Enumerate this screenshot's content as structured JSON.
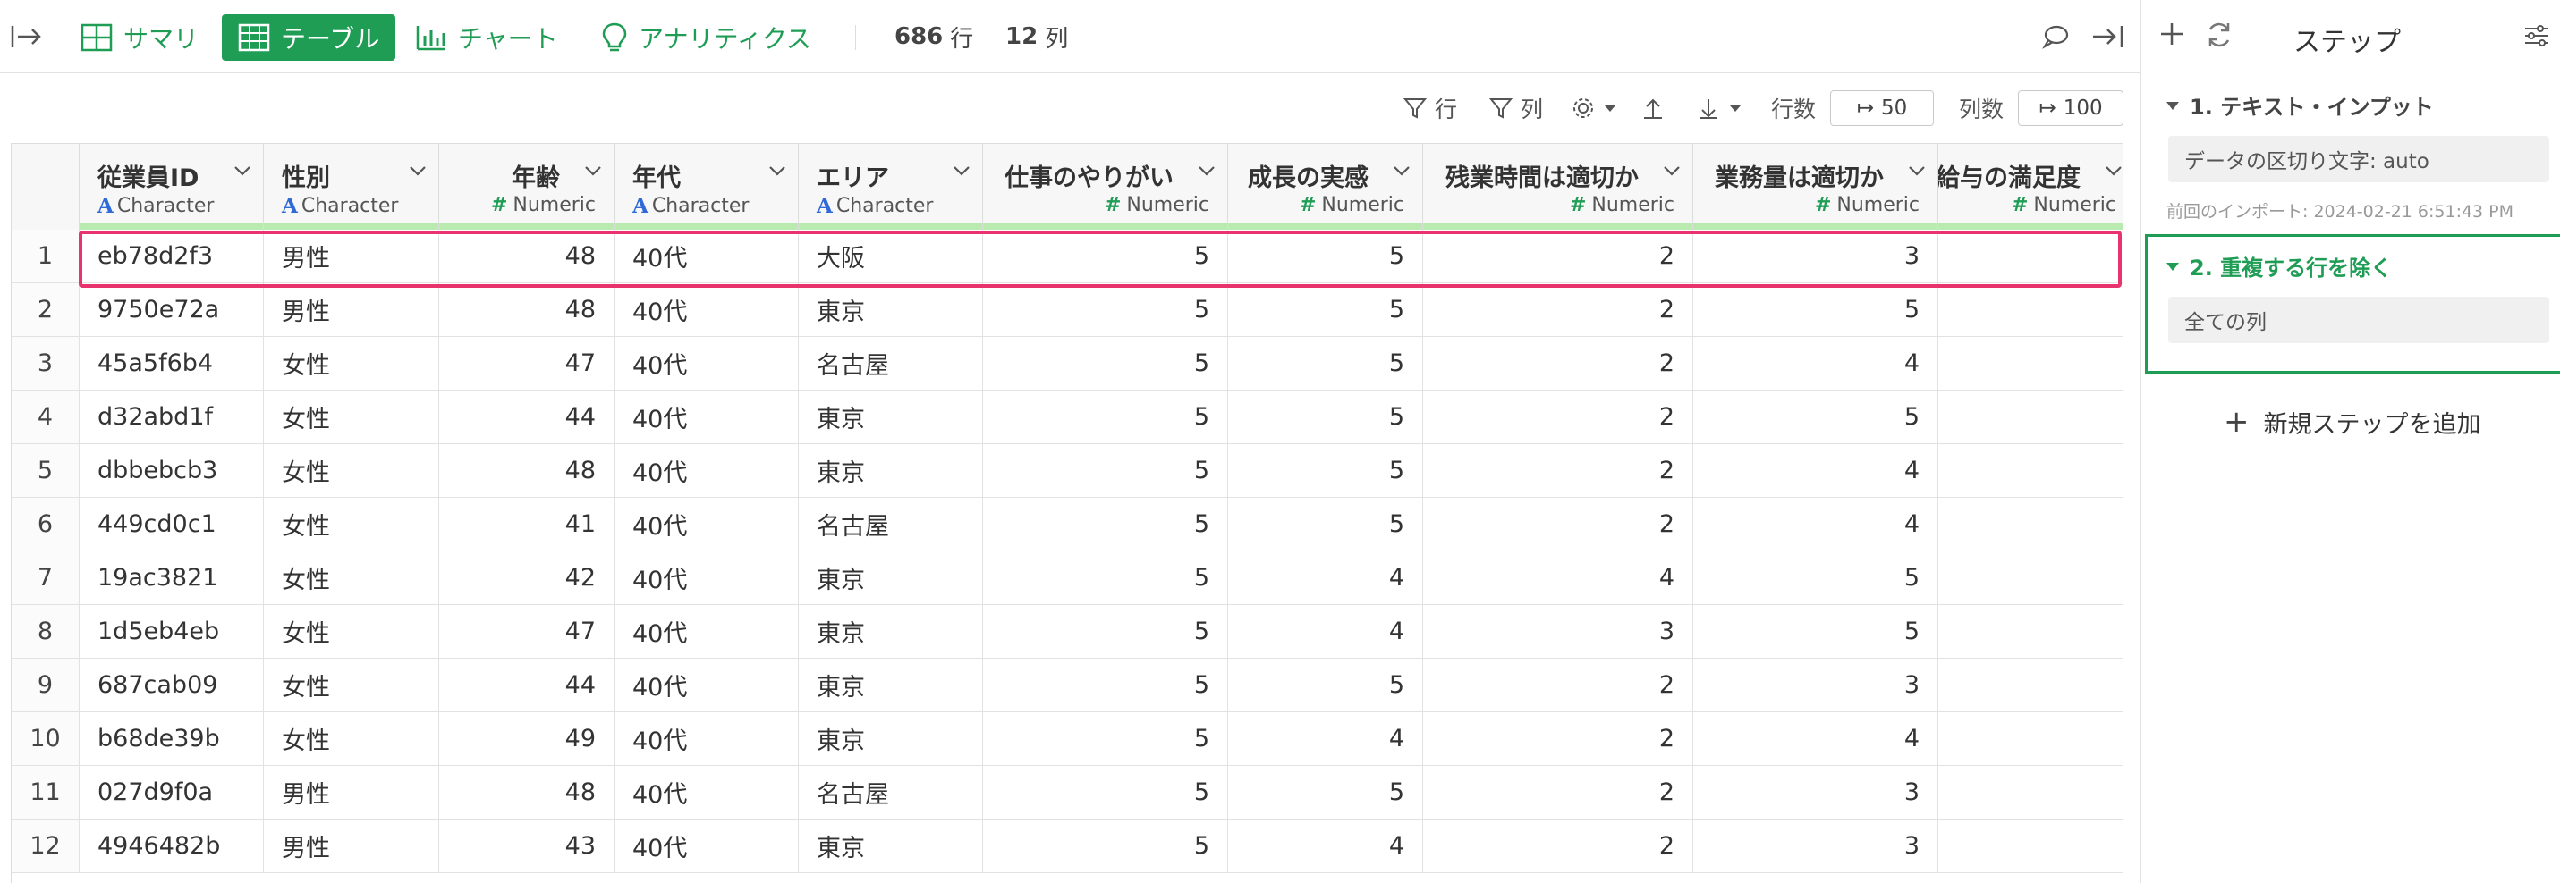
{
  "toolbar": {
    "tabs": [
      {
        "label": "サマリ",
        "active": false
      },
      {
        "label": "テーブル",
        "active": true
      },
      {
        "label": "チャート",
        "active": false
      },
      {
        "label": "アナリティクス",
        "active": false
      }
    ],
    "row_count": "686",
    "row_unit": "行",
    "col_count": "12",
    "col_unit": "列"
  },
  "options": {
    "row_filter": "行",
    "col_filter": "列",
    "rows_label": "行数",
    "rows_value": "50",
    "cols_label": "列数",
    "cols_value": "100"
  },
  "table": {
    "columns": [
      {
        "name": "従業員ID",
        "type": "Character"
      },
      {
        "name": "性別",
        "type": "Character"
      },
      {
        "name": "年齢",
        "type": "Numeric"
      },
      {
        "name": "年代",
        "type": "Character"
      },
      {
        "name": "エリア",
        "type": "Character"
      },
      {
        "name": "仕事のやりがい",
        "type": "Numeric"
      },
      {
        "name": "成長の実感",
        "type": "Numeric"
      },
      {
        "name": "残業時間は適切か",
        "type": "Numeric"
      },
      {
        "name": "業務量は適切か",
        "type": "Numeric"
      },
      {
        "name": "給与の満足度",
        "type": "Numeric"
      }
    ],
    "rows": [
      {
        "idx": "1",
        "cells": [
          "eb78d2f3",
          "男性",
          "48",
          "40代",
          "大阪",
          "5",
          "5",
          "2",
          "3",
          ""
        ]
      },
      {
        "idx": "2",
        "cells": [
          "9750e72a",
          "男性",
          "48",
          "40代",
          "東京",
          "5",
          "5",
          "2",
          "5",
          ""
        ]
      },
      {
        "idx": "3",
        "cells": [
          "45a5f6b4",
          "女性",
          "47",
          "40代",
          "名古屋",
          "5",
          "5",
          "2",
          "4",
          ""
        ]
      },
      {
        "idx": "4",
        "cells": [
          "d32abd1f",
          "女性",
          "44",
          "40代",
          "東京",
          "5",
          "5",
          "2",
          "5",
          ""
        ]
      },
      {
        "idx": "5",
        "cells": [
          "dbbebcb3",
          "女性",
          "48",
          "40代",
          "東京",
          "5",
          "5",
          "2",
          "4",
          ""
        ]
      },
      {
        "idx": "6",
        "cells": [
          "449cd0c1",
          "女性",
          "41",
          "40代",
          "名古屋",
          "5",
          "5",
          "2",
          "4",
          ""
        ]
      },
      {
        "idx": "7",
        "cells": [
          "19ac3821",
          "女性",
          "42",
          "40代",
          "東京",
          "5",
          "4",
          "4",
          "5",
          ""
        ]
      },
      {
        "idx": "8",
        "cells": [
          "1d5eb4eb",
          "女性",
          "47",
          "40代",
          "東京",
          "5",
          "4",
          "3",
          "5",
          ""
        ]
      },
      {
        "idx": "9",
        "cells": [
          "687cab09",
          "女性",
          "44",
          "40代",
          "東京",
          "5",
          "5",
          "2",
          "3",
          ""
        ]
      },
      {
        "idx": "10",
        "cells": [
          "b68de39b",
          "女性",
          "49",
          "40代",
          "東京",
          "5",
          "4",
          "2",
          "4",
          ""
        ]
      },
      {
        "idx": "11",
        "cells": [
          "027d9f0a",
          "男性",
          "48",
          "40代",
          "名古屋",
          "5",
          "5",
          "2",
          "3",
          ""
        ]
      },
      {
        "idx": "12",
        "cells": [
          "4946482b",
          "男性",
          "43",
          "40代",
          "東京",
          "5",
          "4",
          "2",
          "3",
          ""
        ]
      }
    ]
  },
  "panel": {
    "title": "ステップ",
    "steps": [
      {
        "title": "1. テキスト・インプット",
        "detail": "データの区切り文字: auto",
        "meta": "前回のインポート: 2024-02-21 6:51:43 PM"
      },
      {
        "title": "2. 重複する行を除く",
        "detail": "全ての列"
      }
    ],
    "add_step": "新規ステップを追加"
  },
  "colors": {
    "accent": "#1f9d55",
    "highlight": "#e8336f",
    "char_type": "#2f6ad8"
  }
}
